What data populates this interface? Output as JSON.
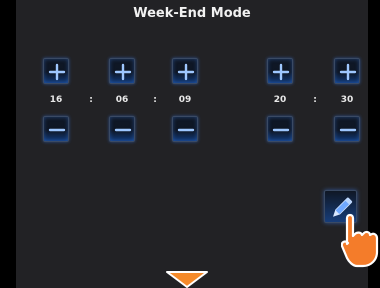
{
  "screen": {
    "title": "Week-End Mode"
  },
  "time_fields": [
    {
      "value": "16"
    },
    {
      "value": "06"
    },
    {
      "value": "09"
    },
    {
      "value": "20"
    },
    {
      "value": "30"
    }
  ],
  "separators": [
    ":",
    ":",
    ":"
  ],
  "icons": {
    "increment": "plus-icon",
    "decrement": "minus-icon",
    "edit": "pencil-icon",
    "pointer": "hand-pointer-icon",
    "scroll": "down-arrow-icon"
  },
  "colors": {
    "background": "#222225",
    "button_glow": "#2a7bff",
    "arrow": "#f58a2a"
  }
}
